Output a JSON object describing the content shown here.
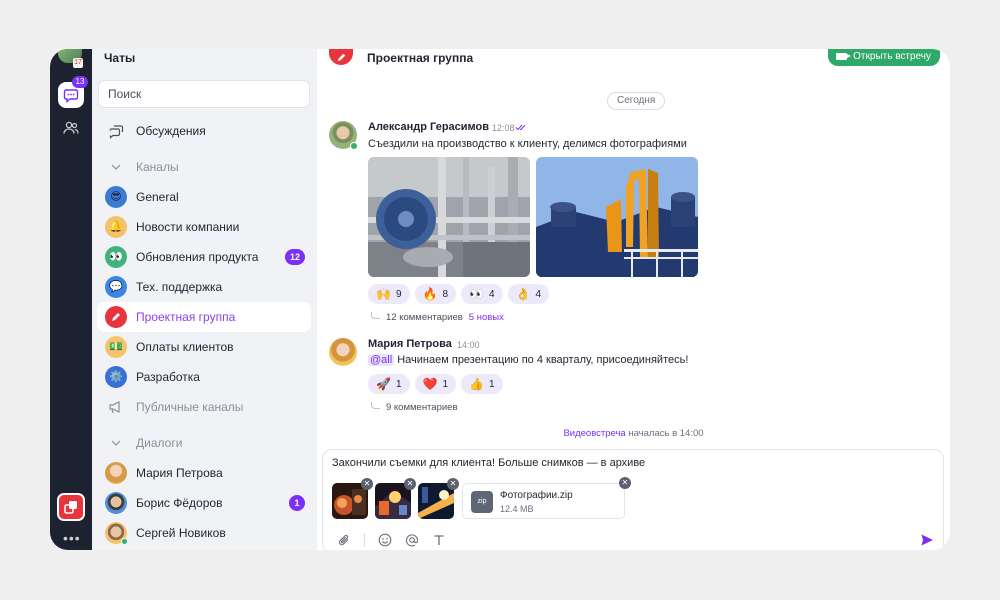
{
  "rail": {
    "chat_badge": "13",
    "avatar_badge": "17"
  },
  "sidebar": {
    "title": "Чаты",
    "search_placeholder": "Поиск",
    "discussions": "Обсуждения",
    "channels_section": "Каналы",
    "channels": [
      {
        "label": "General",
        "icon": "sunglasses-emoji-icon",
        "color": "#3a7bd5"
      },
      {
        "label": "Новости компании",
        "icon": "bell-emoji-icon",
        "color": "#f3c26b"
      },
      {
        "label": "Обновления продукта",
        "icon": "eyes-emoji-icon",
        "color": "#3fb27f",
        "badge": "12"
      },
      {
        "label": "Тех. поддержка",
        "icon": "speech-bubble-emoji-icon",
        "color": "#3a86e8"
      },
      {
        "label": "Проектная группа",
        "icon": "pen-emoji-icon",
        "color": "#e8343c",
        "active": true
      },
      {
        "label": "Оплаты клиентов",
        "icon": "money-emoji-icon",
        "color": "#f6c36a"
      },
      {
        "label": "Разработка",
        "icon": "gear-emoji-icon",
        "color": "#3a6fd8"
      }
    ],
    "public_channels": "Публичные каналы",
    "dialogs_section": "Диалоги",
    "dialogs": [
      {
        "label": "Мария Петрова"
      },
      {
        "label": "Борис Фёдоров",
        "badge": "1"
      },
      {
        "label": "Сергей Новиков"
      }
    ]
  },
  "header": {
    "title": "Проектная группа",
    "meet_button": "Открыть встречу"
  },
  "feed": {
    "date_chip": "Сегодня",
    "messages": [
      {
        "author": "Александр Герасимов",
        "time": "12:08",
        "text": "Съездили на производство к клиенту, делимся фотографиями",
        "reactions": [
          {
            "emoji": "🙌",
            "count": "9"
          },
          {
            "emoji": "🔥",
            "count": "8"
          },
          {
            "emoji": "👀",
            "count": "4"
          },
          {
            "emoji": "👌",
            "count": "4"
          }
        ],
        "thread_count": "12 комментариев",
        "thread_new": "5 новых"
      },
      {
        "author": "Мария Петрова",
        "time": "14:00",
        "mention": "@all",
        "text": "Начинаем презентацию по 4 кварталу, присоединяйтесь!",
        "reactions": [
          {
            "emoji": "🚀",
            "count": "1"
          },
          {
            "emoji": "❤️",
            "count": "1"
          },
          {
            "emoji": "👍",
            "count": "1"
          }
        ],
        "thread_count": "9 комментариев"
      }
    ],
    "system": {
      "link": "Видеовстреча",
      "text": " началась в 14:00"
    }
  },
  "composer": {
    "text": "Закончили съемки для клиента! Больше снимков — в архиве",
    "file": {
      "ext": "zip",
      "name": "Фотографии.zip",
      "size": "12.4 MB"
    }
  },
  "colors": {
    "accent": "#7b2ff7",
    "rail": "#1d2230",
    "meet": "#2fa86b"
  }
}
